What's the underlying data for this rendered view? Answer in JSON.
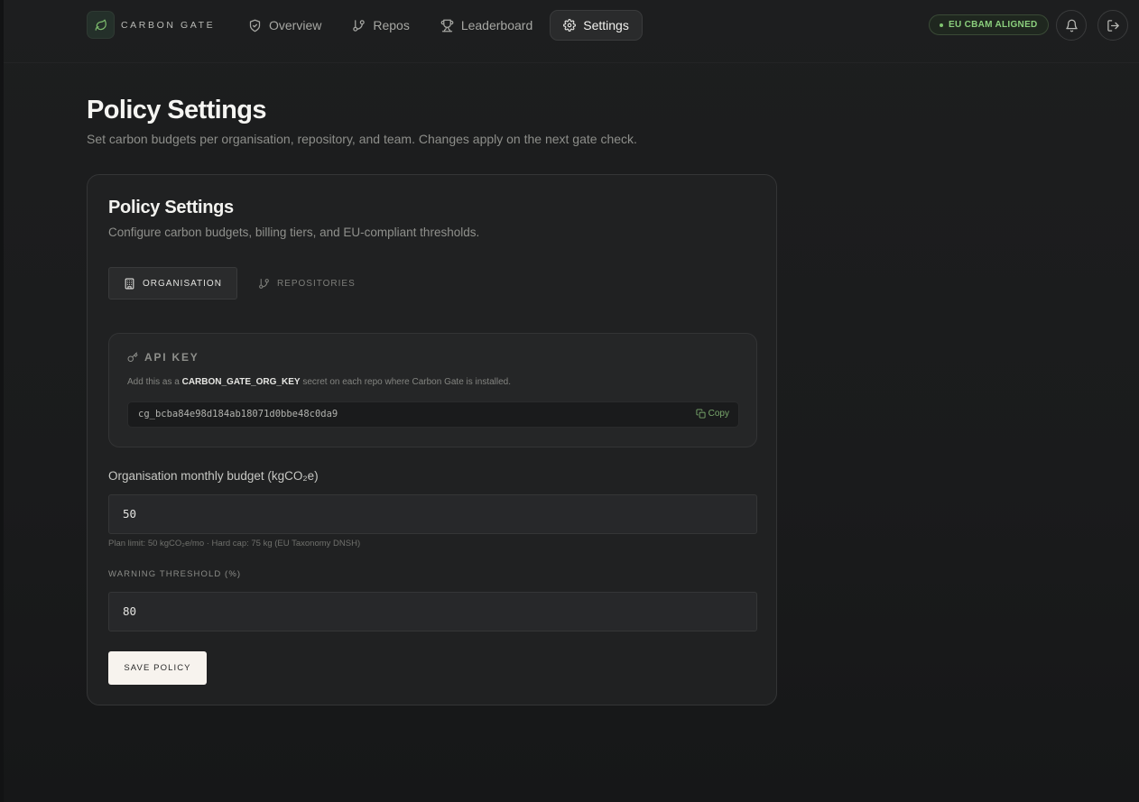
{
  "brand": {
    "name": "CARBON GATE"
  },
  "nav": {
    "items": [
      {
        "label": "Overview",
        "icon": "shield-check-icon"
      },
      {
        "label": "Repos",
        "icon": "git-branch-icon"
      },
      {
        "label": "Leaderboard",
        "icon": "trophy-icon"
      },
      {
        "label": "Settings",
        "icon": "gear-icon"
      }
    ],
    "active": "Settings"
  },
  "badge": {
    "label": "EU CBAM ALIGNED"
  },
  "header": {
    "title": "Policy Settings",
    "subtitle": "Set carbon budgets per organisation, repository, and team. Changes apply on the next gate check."
  },
  "card": {
    "title": "Policy Settings",
    "subtitle": "Configure carbon budgets, billing tiers, and EU-compliant thresholds.",
    "tabs": [
      {
        "label": "ORGANISATION",
        "icon": "building-icon"
      },
      {
        "label": "REPOSITORIES",
        "icon": "git-branch-icon"
      }
    ],
    "api_key": {
      "heading": "API KEY",
      "desc_prefix": "Add this as a",
      "secret_name": "CARBON_GATE_ORG_KEY",
      "desc_suffix": "secret on each repo where Carbon Gate is installed.",
      "value": "cg_bcba84e98d184ab18071d0bbe48c0da9",
      "copy_label": "Copy"
    },
    "budget": {
      "label": "Organisation monthly budget (kgCO₂e)",
      "value": "50",
      "hint": "Plan limit: 50 kgCO₂e/mo · Hard cap: 75 kg (EU Taxonomy DNSH)"
    },
    "threshold": {
      "label": "WARNING THRESHOLD (%)",
      "value": "80"
    },
    "save_label": "SAVE POLICY"
  },
  "colors": {
    "accent_green": "#8bcf7d",
    "background": "#1a1b1c",
    "card": "#202122",
    "button": "#f7f3ee"
  }
}
